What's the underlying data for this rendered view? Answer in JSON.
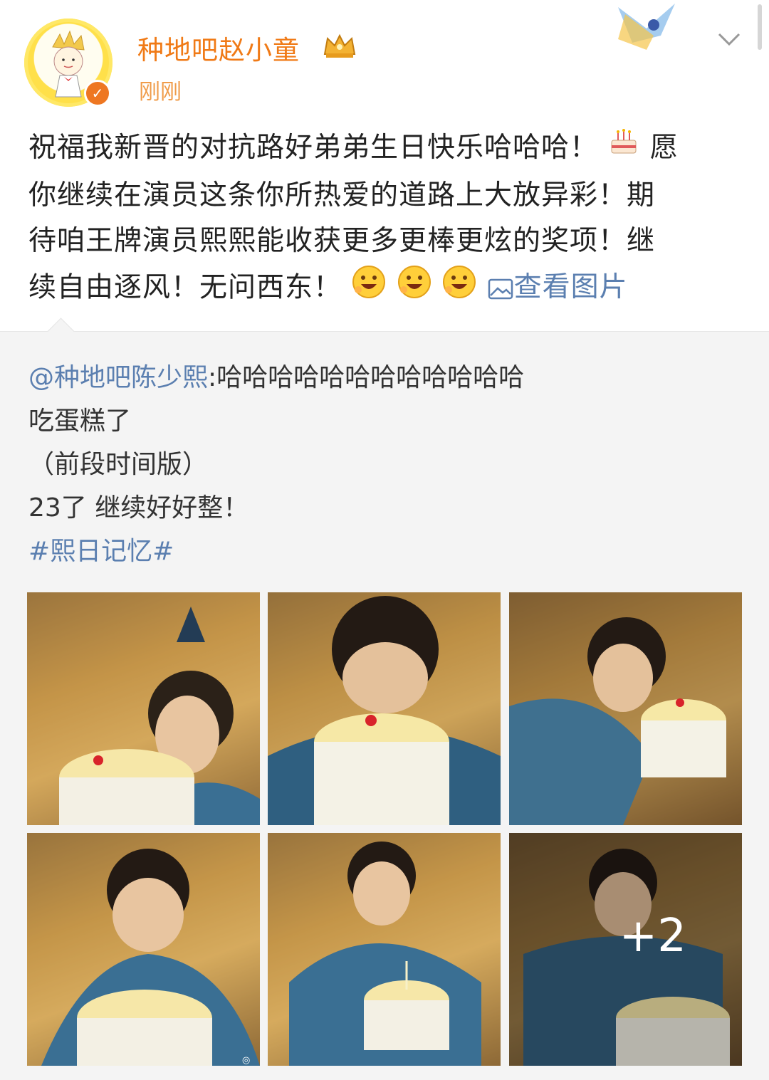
{
  "post": {
    "username": "种地吧赵小童",
    "timestamp": "刚刚",
    "text_lines": [
      "祝福我新晋的对抗路好弟弟生日快乐哈哈哈！",
      "愿",
      "你继续在演员这条你所热爱的道路上大放异彩！期",
      "待咱王牌演员熙熙能收获更多更棒更炫的奖项！继",
      "续自由逐风！无问西东！"
    ],
    "view_images_label": "查看图片",
    "icons": {
      "avatar": "little-prince-avatar",
      "verified": "verified-badge-icon",
      "crown": "crown-icon",
      "more": "chevron-down-icon",
      "cake": "birthday-cake-emoji",
      "grin": "grinning-emoji",
      "image": "image-icon"
    }
  },
  "repost": {
    "mention": "@种地吧陈少熙",
    "text_first": ":哈哈哈哈哈哈哈哈哈哈哈哈",
    "lines": [
      "吃蛋糕了",
      "（前段时间版）",
      "23了 继续好好整！"
    ],
    "hashtag": "#熙日记忆#",
    "more_photos": "+2"
  },
  "colors": {
    "username": "#f07a16",
    "link": "#5b7fb0",
    "repost_bg": "#f4f4f4"
  }
}
